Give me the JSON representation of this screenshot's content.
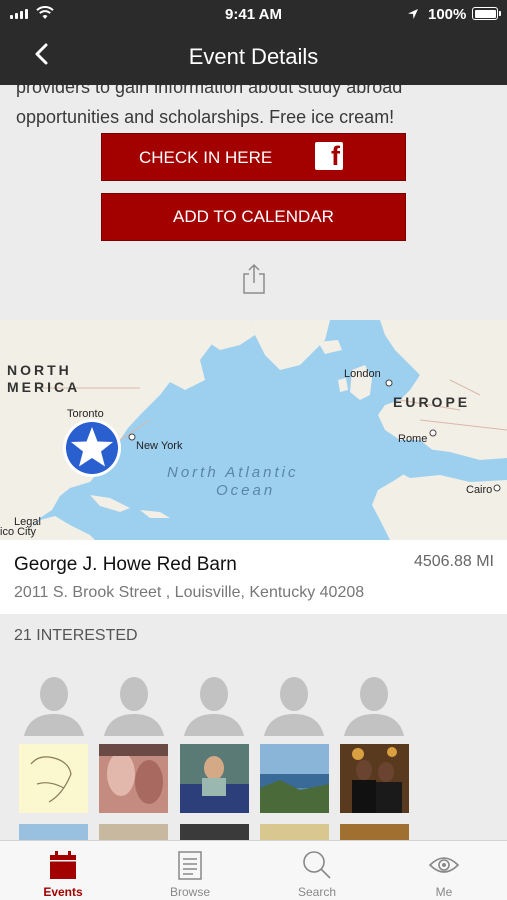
{
  "status_bar": {
    "time": "9:41 AM",
    "battery": "100%"
  },
  "nav": {
    "title": "Event Details"
  },
  "event": {
    "description_line1": "providers to gain information about study abroad",
    "description_line2": "opportunities and scholarships. Free ice cream!"
  },
  "actions": {
    "check_in_label": "CHECK IN HERE",
    "add_to_calendar_label": "ADD TO CALENDAR"
  },
  "map": {
    "labels": {
      "north_america_1": "NORTH",
      "north_america_2": "MERICA",
      "toronto": "Toronto",
      "new_york": "New York",
      "london": "London",
      "europe": "EUROPE",
      "rome": "Rome",
      "ocean_1": "North Atlantic",
      "ocean_2": "Ocean",
      "cairo": "Cairo",
      "legal": "Legal",
      "mexico_city": "ico City"
    }
  },
  "venue": {
    "name": "George J. Howe Red Barn",
    "distance": "4506.88 MI",
    "address": "2011 S. Brook Street , Louisville, Kentucky 40208"
  },
  "interested": {
    "label": "21 INTERESTED"
  },
  "tabs": [
    {
      "label": "Events",
      "icon": "calendar-icon",
      "active": true
    },
    {
      "label": "Browse",
      "icon": "document-icon",
      "active": false
    },
    {
      "label": "Search",
      "icon": "search-icon",
      "active": false
    },
    {
      "label": "Me",
      "icon": "eye-icon",
      "active": false
    }
  ],
  "colors": {
    "accent": "#a30000",
    "nav_bar": "#2b2b2b",
    "map_water": "#9dd0ef",
    "map_land": "#f2efe6",
    "pin": "#2a5fd0"
  }
}
